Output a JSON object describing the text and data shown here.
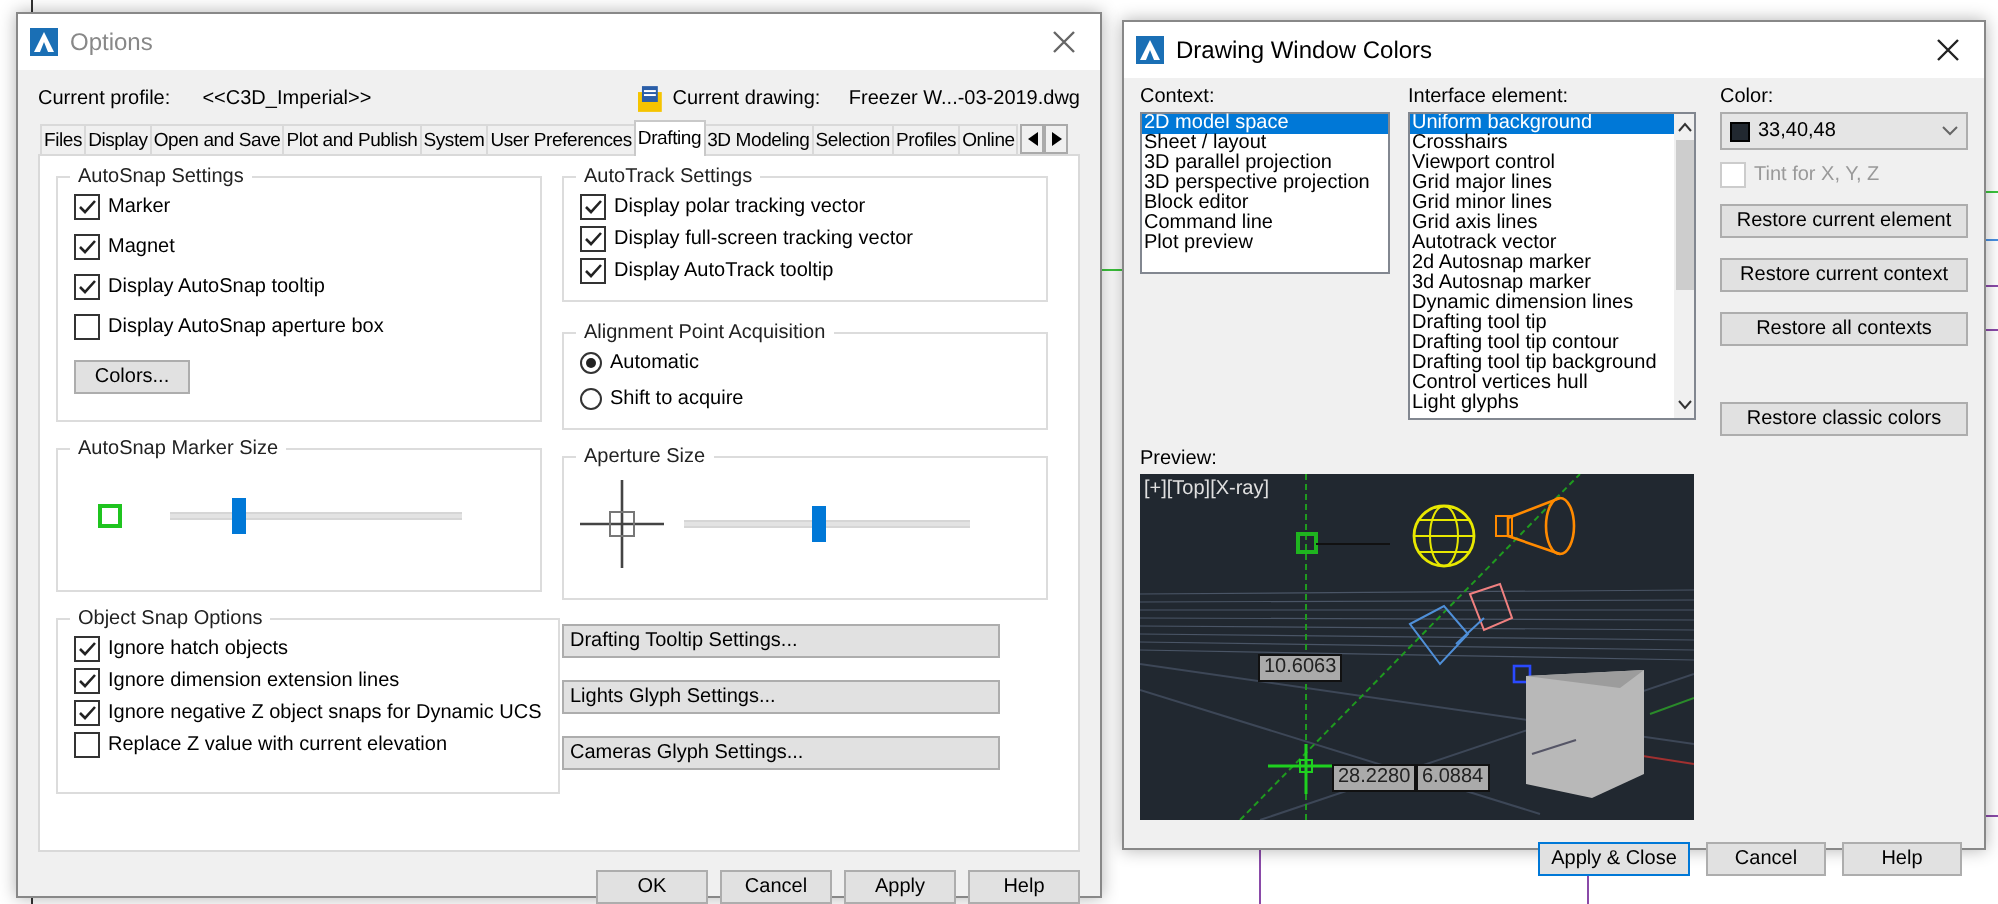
{
  "options_window": {
    "title": "Options",
    "profile_label": "Current profile:",
    "profile_value": "<<C3D_Imperial>>",
    "drawing_label": "Current drawing:",
    "drawing_value": "Freezer W...-03-2019.dwg",
    "tabs": [
      {
        "label": "Files",
        "selected": false
      },
      {
        "label": "Display",
        "selected": false
      },
      {
        "label": "Open and Save",
        "selected": false
      },
      {
        "label": "Plot and Publish",
        "selected": false
      },
      {
        "label": "System",
        "selected": false
      },
      {
        "label": "User Preferences",
        "selected": false
      },
      {
        "label": "Drafting",
        "selected": true
      },
      {
        "label": "3D Modeling",
        "selected": false
      },
      {
        "label": "Selection",
        "selected": false
      },
      {
        "label": "Profiles",
        "selected": false
      },
      {
        "label": "Online",
        "selected": false
      }
    ],
    "autosnap": {
      "title": "AutoSnap Settings",
      "options": [
        {
          "label": "Marker",
          "checked": true
        },
        {
          "label": "Magnet",
          "checked": true
        },
        {
          "label": "Display AutoSnap tooltip",
          "checked": true
        },
        {
          "label": "Display AutoSnap aperture box",
          "checked": false
        }
      ],
      "colors_button": "Colors..."
    },
    "autotrack": {
      "title": "AutoTrack Settings",
      "options": [
        {
          "label": "Display polar tracking vector",
          "checked": true
        },
        {
          "label": "Display full-screen tracking vector",
          "checked": true
        },
        {
          "label": "Display AutoTrack tooltip",
          "checked": true
        }
      ]
    },
    "alignment": {
      "title": "Alignment Point Acquisition",
      "options": [
        {
          "label": "Automatic",
          "selected": true
        },
        {
          "label": "Shift to acquire",
          "selected": false
        }
      ]
    },
    "marker_size": {
      "title": "AutoSnap Marker Size",
      "level": 0.23
    },
    "aperture_size": {
      "title": "Aperture Size",
      "level": 0.47
    },
    "object_snap": {
      "title": "Object Snap Options",
      "options": [
        {
          "label": "Ignore hatch objects",
          "checked": true
        },
        {
          "label": "Ignore dimension extension lines",
          "checked": true
        },
        {
          "label": "Ignore negative Z object snaps for Dynamic UCS",
          "checked": true
        },
        {
          "label": "Replace Z value with current elevation",
          "checked": false
        }
      ]
    },
    "settings_buttons": [
      "Drafting Tooltip Settings...",
      "Lights Glyph Settings...",
      "Cameras Glyph Settings..."
    ],
    "buttons": [
      "OK",
      "Cancel",
      "Apply",
      "Help"
    ]
  },
  "colors_window": {
    "title": "Drawing Window Colors",
    "context": {
      "label": "Context:",
      "items": [
        {
          "label": "2D model space",
          "selected": true
        },
        {
          "label": "Sheet / layout",
          "selected": false
        },
        {
          "label": "3D parallel projection",
          "selected": false
        },
        {
          "label": "3D perspective projection",
          "selected": false
        },
        {
          "label": "Block editor",
          "selected": false
        },
        {
          "label": "Command line",
          "selected": false
        },
        {
          "label": "Plot preview",
          "selected": false
        }
      ]
    },
    "interface": {
      "label": "Interface element:",
      "items": [
        {
          "label": "Uniform background",
          "selected": true
        },
        {
          "label": "Crosshairs",
          "selected": false
        },
        {
          "label": "Viewport control",
          "selected": false
        },
        {
          "label": "Grid major lines",
          "selected": false
        },
        {
          "label": "Grid minor lines",
          "selected": false
        },
        {
          "label": "Grid axis lines",
          "selected": false
        },
        {
          "label": "Autotrack vector",
          "selected": false
        },
        {
          "label": "2d Autosnap marker",
          "selected": false
        },
        {
          "label": "3d Autosnap marker",
          "selected": false
        },
        {
          "label": "Dynamic dimension lines",
          "selected": false
        },
        {
          "label": "Drafting tool tip",
          "selected": false
        },
        {
          "label": "Drafting tool tip contour",
          "selected": false
        },
        {
          "label": "Drafting tool tip background",
          "selected": false
        },
        {
          "label": "Control vertices hull",
          "selected": false
        },
        {
          "label": "Light glyphs",
          "selected": false
        }
      ]
    },
    "color": {
      "label": "Color:",
      "value": "33,40,48"
    },
    "tint": {
      "label": "Tint for X, Y, Z",
      "checked": false,
      "disabled": true
    },
    "restore_buttons": [
      "Restore current element",
      "Restore current context",
      "Restore all contexts",
      "Restore classic colors"
    ],
    "preview": {
      "label": "Preview:",
      "viewport_label": "[+][Top][X-ray]",
      "readouts": [
        "10.6063",
        "28.2280",
        "6.0884"
      ]
    },
    "buttons": [
      {
        "label": "Apply & Close",
        "default": true
      },
      {
        "label": "Cancel",
        "default": false
      },
      {
        "label": "Help",
        "default": false
      }
    ]
  }
}
